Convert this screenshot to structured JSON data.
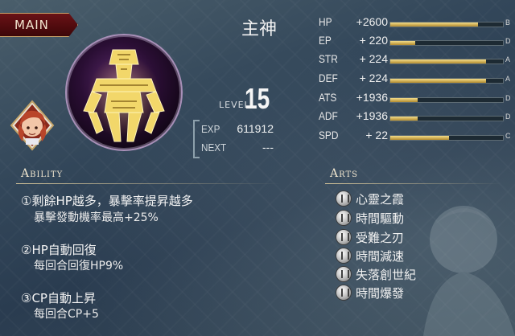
{
  "tab": {
    "label": "MAIN"
  },
  "character": {
    "name": "主神"
  },
  "level": {
    "label": "LEVEL",
    "value": "15"
  },
  "experience": {
    "exp_label": "EXP",
    "exp_value": "611912",
    "next_label": "NEXT",
    "next_value": "---"
  },
  "stats": [
    {
      "name": "HP",
      "value": "+2600",
      "grade": "B",
      "fill": 0.78
    },
    {
      "name": "EP",
      "value": "+ 220",
      "grade": "D",
      "fill": 0.22
    },
    {
      "name": "STR",
      "value": "+ 224",
      "grade": "A",
      "fill": 0.85
    },
    {
      "name": "DEF",
      "value": "+ 224",
      "grade": "A",
      "fill": 0.85
    },
    {
      "name": "ATS",
      "value": "+1936",
      "grade": "D",
      "fill": 0.24
    },
    {
      "name": "ADF",
      "value": "+1936",
      "grade": "D",
      "fill": 0.24
    },
    {
      "name": "SPD",
      "value": "+  22",
      "grade": "C",
      "fill": 0.52
    }
  ],
  "ability": {
    "header": "Ability",
    "items": [
      {
        "title": "①剩餘HP越多，暴擊率提昇越多",
        "desc": "暴擊發動機率最高+25%"
      },
      {
        "title": "②HP自動回復",
        "desc": "每回合回復HP9%"
      },
      {
        "title": "③CP自動上昇",
        "desc": "每回合CP+5"
      }
    ]
  },
  "arts": {
    "header": "Arts",
    "items": [
      "心靈之霞",
      "時間驅動",
      "受難之刃",
      "時間減速",
      "失落創世紀",
      "時間爆發"
    ]
  },
  "colors": {
    "tab_bg": "#5a0c10",
    "bar_fill": "#e8c865",
    "accent_gold": "#e6d2a0"
  },
  "icons": {
    "art": "time-seal-icon",
    "orb": "golden-idol-orb-icon",
    "portrait": "character-portrait"
  }
}
